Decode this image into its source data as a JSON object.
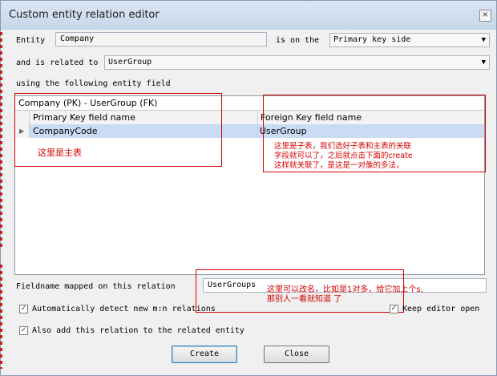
{
  "window": {
    "title": "Custom entity relation editor",
    "close_glyph": "×"
  },
  "entity": {
    "label": "Entity",
    "value": "Company"
  },
  "side": {
    "label": "is on the",
    "value": "Primary key side"
  },
  "related": {
    "label": "and is related to",
    "value": "UserGroup"
  },
  "using_label": "using the following entity field",
  "grid": {
    "caption": "Company (PK) - UserGroup (FK)",
    "columns": [
      "Primary Key field name",
      "Foreign Key field name"
    ],
    "rows": [
      {
        "pk": "CompanyCode",
        "fk": "UserGroup"
      }
    ]
  },
  "annotations": {
    "main_table": "这里是主表",
    "child_table_line1": "这里是子表，我们选好子表和主表的关联",
    "child_table_line2": "字段就可以了，之后就点击下面的create",
    "child_table_line3": "这样就关联了，是这是一对像的多法，",
    "rename_line1": "这里可以改名，比如是1对多，给它加上个s,",
    "rename_line2": "那别人一看就知道 了"
  },
  "fieldname": {
    "label": "Fieldname mapped on this relation",
    "value": "UserGroups"
  },
  "options": {
    "auto_detect": {
      "label": "Automatically detect new m:n relations",
      "checked": true
    },
    "keep_open": {
      "label": "Keep editor open",
      "checked": true
    },
    "also_add": {
      "label": "Also add this relation to the related entity",
      "checked": true
    }
  },
  "buttons": {
    "create": "Create",
    "close": "Close"
  },
  "colors": {
    "annotation": "#d40000",
    "selected_row": "#c9dcf4"
  }
}
